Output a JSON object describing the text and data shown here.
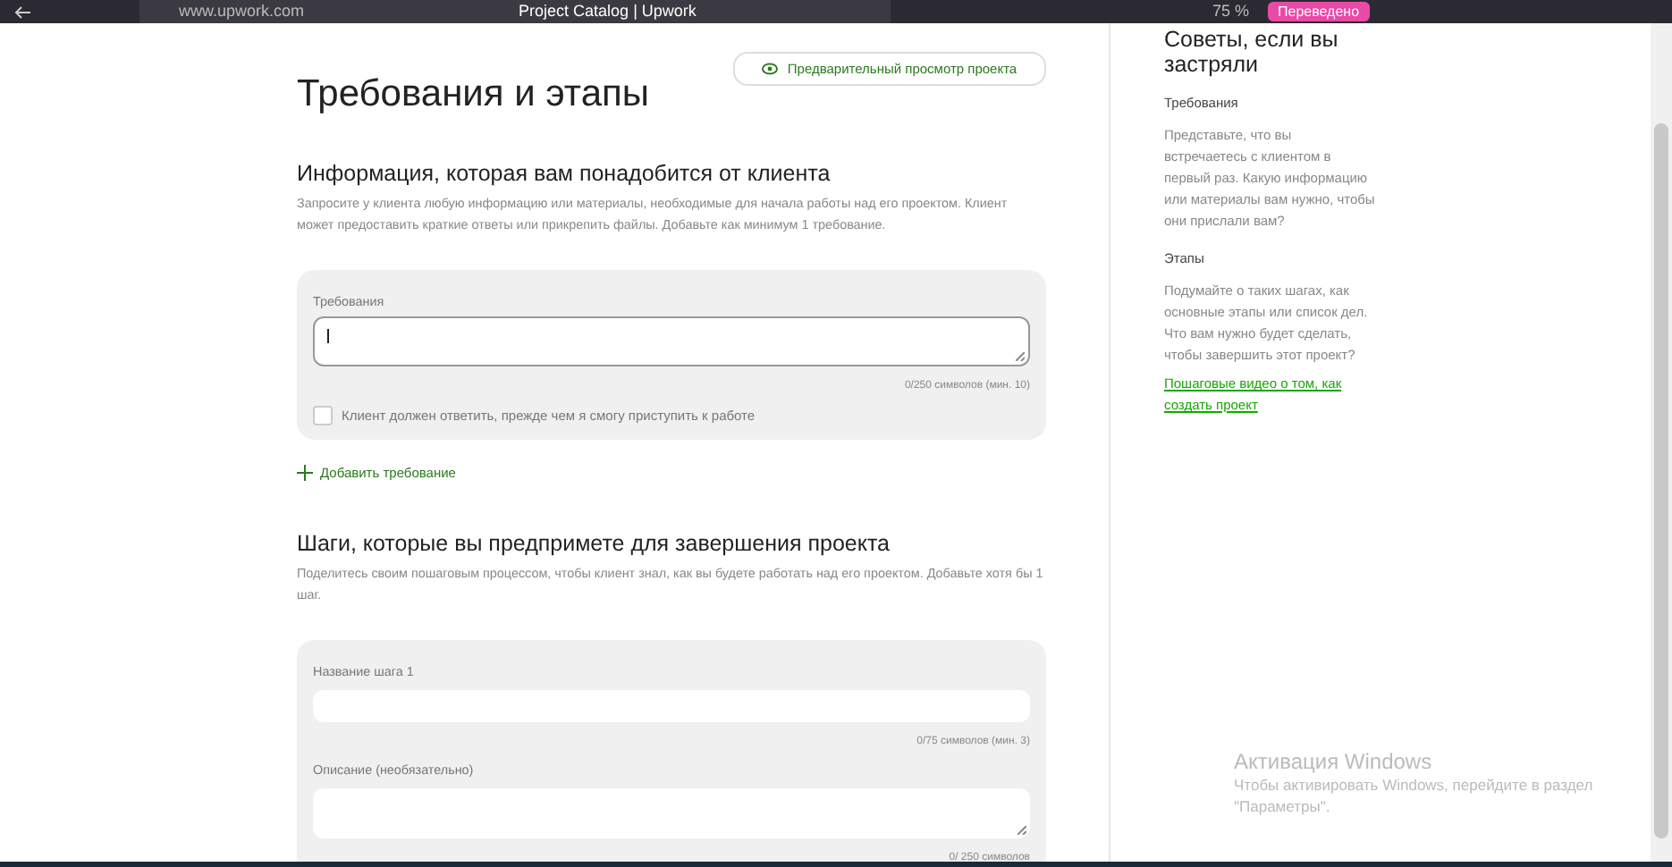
{
  "browser": {
    "url": "www.upwork.com",
    "title": "Project Catalog | Upwork",
    "zoom": "75 %",
    "translate_badge": "Переведено"
  },
  "page": {
    "title": "Требования и этапы",
    "preview_button": "Предварительный просмотр проекта"
  },
  "requirements": {
    "heading": "Информация, которая вам понадобится от клиента",
    "description": "Запросите у клиента любую информацию или материалы, необходимые для начала работы над его проектом. Клиент может предоставить краткие ответы или прикрепить файлы. Добавьте как минимум 1 требование.",
    "field_label": "Требования",
    "counter": "0/250 символов (мин. 10)",
    "checkbox": {
      "label": "Клиент должен ответить, прежде чем я смогу приступить к работе",
      "checked": false
    },
    "add_button": "Добавить требование"
  },
  "steps": {
    "heading": "Шаги, которые вы предпримете для завершения проекта",
    "description": "Поделитесь своим пошаговым процессом, чтобы клиент знал, как вы будете работать над его проектом. Добавьте хотя бы 1 шаг.",
    "title_label": "Название шага 1",
    "title_counter": "0/75 символов (мин. 3)",
    "description_label": "Описание (необязательно)",
    "description_counter": "0/ 250 символов"
  },
  "tips": {
    "title": "Советы, если вы застряли",
    "sections": [
      {
        "heading": "Требования",
        "text": "Представьте, что вы встречаетесь с клиентом в первый раз. Какую информацию или материалы вам нужно, чтобы они прислали вам?"
      },
      {
        "heading": "Этапы",
        "text": "Подумайте о таких шагах, как основные этапы или список дел. Что вам нужно будет сделать, чтобы завершить этот проект?"
      }
    ],
    "link": "Пошаговые видео о том, как создать проект"
  },
  "activation": {
    "title": "Активация Windows",
    "text": "Чтобы активировать Windows, перейдите в раздел \"Параметры\"."
  }
}
